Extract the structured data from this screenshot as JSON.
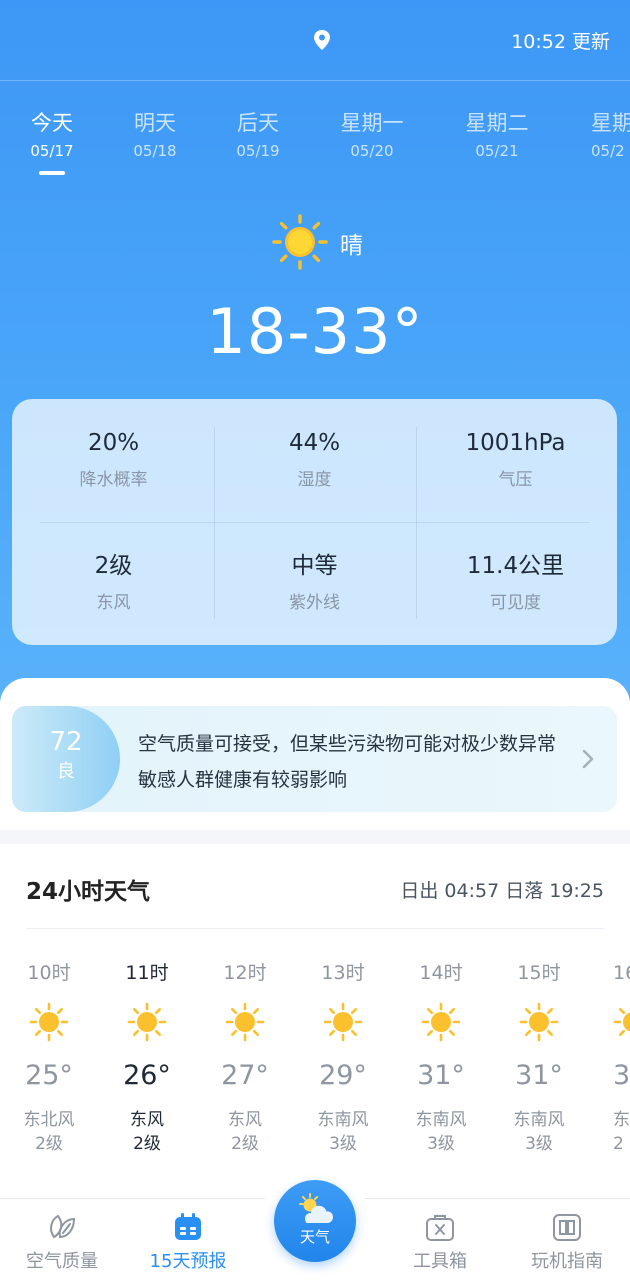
{
  "header": {
    "update_text": "10:52 更新"
  },
  "days": [
    {
      "name": "今天",
      "date": "05/17",
      "active": true
    },
    {
      "name": "明天",
      "date": "05/18"
    },
    {
      "name": "后天",
      "date": "05/19"
    },
    {
      "name": "星期一",
      "date": "05/20"
    },
    {
      "name": "星期二",
      "date": "05/21"
    },
    {
      "name": "星期",
      "date": "05/2"
    }
  ],
  "today": {
    "icon": "sun-icon",
    "condition": "晴",
    "range": "18-33°"
  },
  "details": [
    {
      "value": "20%",
      "label": "降水概率"
    },
    {
      "value": "44%",
      "label": "湿度"
    },
    {
      "value": "1001hPa",
      "label": "气压"
    },
    {
      "value": "2级",
      "label": "东风"
    },
    {
      "value": "中等",
      "label": "紫外线"
    },
    {
      "value": "11.4公里",
      "label": "可见度"
    }
  ],
  "aqi": {
    "value": "72",
    "level": "良",
    "text": "空气质量可接受，但某些污染物可能对极少数异常敏感人群健康有较弱影响"
  },
  "hourly": {
    "title": "24小时天气",
    "sun_times": "日出 04:57  日落  19:25",
    "hours": [
      {
        "time": "10时",
        "temp": "25°",
        "wind_dir": "东北风",
        "wind_level": "2级"
      },
      {
        "time": "11时",
        "temp": "26°",
        "wind_dir": "东风",
        "wind_level": "2级",
        "active": true
      },
      {
        "time": "12时",
        "temp": "27°",
        "wind_dir": "东风",
        "wind_level": "2级"
      },
      {
        "time": "13时",
        "temp": "29°",
        "wind_dir": "东南风",
        "wind_level": "3级"
      },
      {
        "time": "14时",
        "temp": "31°",
        "wind_dir": "东南风",
        "wind_level": "3级"
      },
      {
        "time": "15时",
        "temp": "31°",
        "wind_dir": "东南风",
        "wind_level": "3级"
      },
      {
        "time": "16",
        "temp": "3",
        "wind_dir": "东南",
        "wind_level": "2"
      }
    ]
  },
  "nav": [
    {
      "label": "空气质量",
      "icon": "leaf-icon"
    },
    {
      "label": "15天预报",
      "icon": "calendar-icon",
      "active": true
    },
    {
      "label": "天气",
      "icon": "partly-cloudy-icon",
      "center": true
    },
    {
      "label": "工具箱",
      "icon": "toolbox-icon"
    },
    {
      "label": "玩机指南",
      "icon": "book-icon"
    }
  ],
  "colors": {
    "accent": "#2a8ff2",
    "hero_top": "#3d97f6",
    "aqi_badge": "#8fd0f5",
    "sun": "#fbc02d"
  }
}
